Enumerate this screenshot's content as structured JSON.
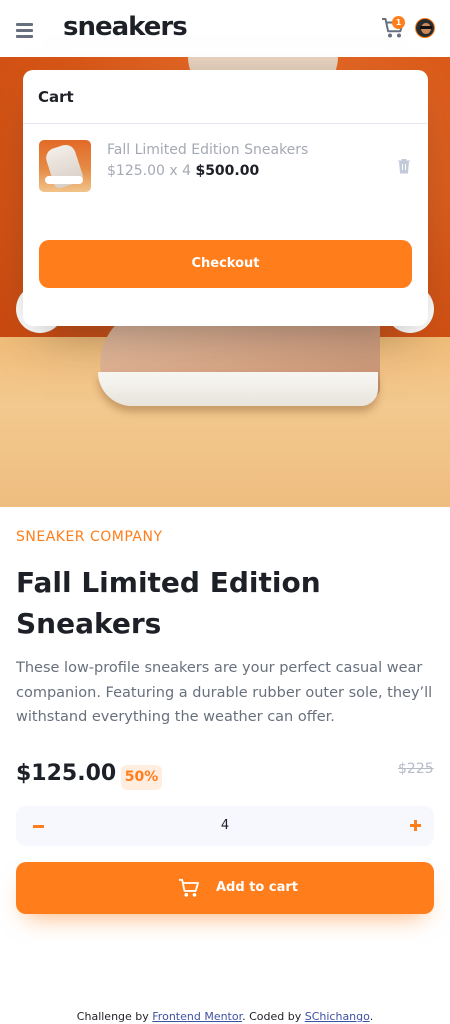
{
  "header": {
    "logo": "sneakers",
    "cart_count": "1"
  },
  "cart": {
    "title": "Cart",
    "item_name": "Fall Limited Edition Sneakers",
    "item_unit_price": "$125.00 x 4",
    "item_total": "$500.00",
    "checkout_label": "Checkout"
  },
  "product": {
    "company": "SNEAKER COMPANY",
    "title": "Fall Limited Edition Sneakers",
    "description": "These low-profile sneakers are your perfect casual wear companion. Featuring a durable rubber outer sole, they’ll withstand everything the weather can offer.",
    "price": "$125.00",
    "discount": "50%",
    "old_price": "$225",
    "quantity": "4",
    "add_to_cart_label": "Add to cart"
  },
  "footer": {
    "prefix": "Challenge by ",
    "link1": "Frontend Mentor",
    "middle": ". Coded by ",
    "link2": "SChichango",
    "suffix": "."
  },
  "colors": {
    "accent": "#ff7e1b",
    "accent_pale": "#ffede0",
    "text_dark": "#1d2026",
    "text_muted": "#69707d"
  },
  "icons": [
    "menu-icon",
    "cart-icon",
    "avatar",
    "delete-icon",
    "minus-icon",
    "plus-icon",
    "previous-icon",
    "next-icon"
  ]
}
